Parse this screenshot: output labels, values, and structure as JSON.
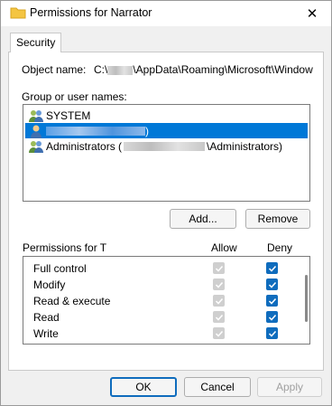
{
  "window": {
    "title": "Permissions for Narrator",
    "close_label": "✕"
  },
  "tabs": [
    {
      "label": "Security"
    }
  ],
  "object": {
    "label": "Object name:",
    "value_prefix": "C:\\",
    "value_suffix": "\\AppData\\Roaming\\Microsoft\\Window"
  },
  "groups": {
    "label": "Group or user names:",
    "items": [
      {
        "name": "SYSTEM",
        "selected": false
      },
      {
        "name": ")",
        "selected": true
      },
      {
        "name_prefix": "Administrators (",
        "name_suffix": "\\Administrators)",
        "selected": false
      }
    ]
  },
  "buttons": {
    "add": "Add...",
    "remove": "Remove",
    "ok": "OK",
    "cancel": "Cancel",
    "apply": "Apply"
  },
  "permissions": {
    "label": "Permissions for T",
    "allow_header": "Allow",
    "deny_header": "Deny",
    "rows": [
      {
        "name": "Full control",
        "allow": true,
        "deny": true
      },
      {
        "name": "Modify",
        "allow": true,
        "deny": true
      },
      {
        "name": "Read & execute",
        "allow": true,
        "deny": true
      },
      {
        "name": "Read",
        "allow": true,
        "deny": true
      },
      {
        "name": "Write",
        "allow": true,
        "deny": true
      }
    ]
  },
  "colors": {
    "accent": "#0f6cbd",
    "selection": "#0078d7"
  }
}
